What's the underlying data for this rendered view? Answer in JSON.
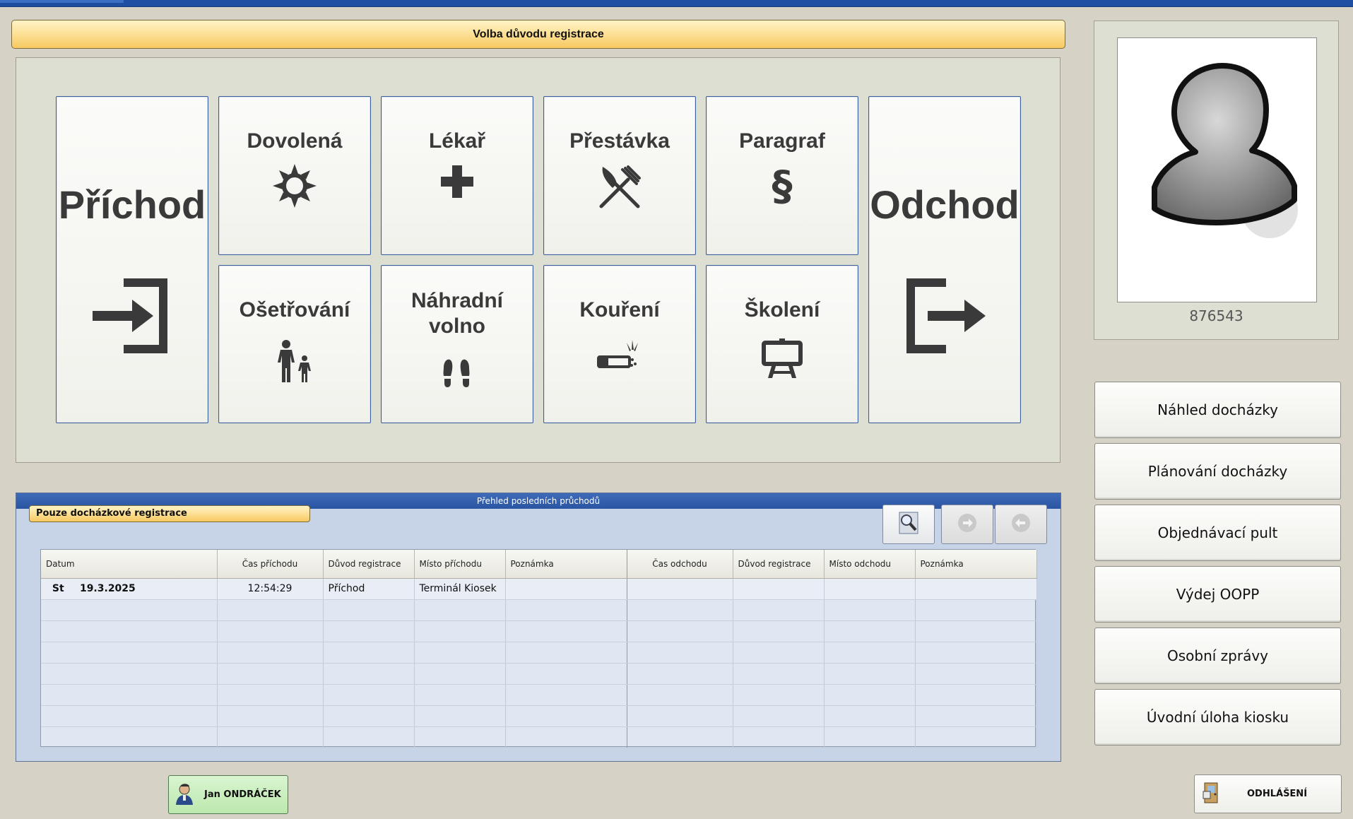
{
  "header": {
    "title": "Volba důvodu registrace"
  },
  "reasons": {
    "arrival": "Příchod",
    "vacation": "Dovolená",
    "doctor": "Lékař",
    "break": "Přestávka",
    "paragraph": "Paragraf",
    "departure": "Odchod",
    "care": "Ošetřování",
    "compensatory": "Náhradní volno",
    "smoking": "Kouření",
    "training": "Školení"
  },
  "employee": {
    "id": "876543",
    "name": "Jan ONDRÁČEK"
  },
  "side_menu": {
    "attendance_preview": "Náhled docházky",
    "attendance_planning": "Plánování docházky",
    "order_desk": "Objednávací pult",
    "ppe_issue": "Výdej OOPP",
    "personal_messages": "Osobní zprávy",
    "kiosk_home": "Úvodní úloha kiosku"
  },
  "history": {
    "title": "Přehled posledních průchodů",
    "filter_label": "Pouze docházkové registrace",
    "columns": {
      "date": "Datum",
      "arrival_time": "Čas příchodu",
      "arrival_reason": "Důvod registrace",
      "arrival_place": "Místo příchodu",
      "arrival_note": "Poznámka",
      "departure_time": "Čas odchodu",
      "departure_reason": "Důvod registrace",
      "departure_place": "Místo odchodu",
      "departure_note": "Poznámka"
    },
    "rows": [
      {
        "day": "St",
        "date": "19.3.2025",
        "arrival_time": "12:54:29",
        "arrival_reason": "Příchod",
        "arrival_place": "Terminál Kiosek",
        "arrival_note": "",
        "departure_time": "",
        "departure_reason": "",
        "departure_place": "",
        "departure_note": ""
      }
    ]
  },
  "logout": {
    "label": "ODHLÁŠENÍ"
  },
  "colors": {
    "title_gold": "#f7c960",
    "history_blue": "#2a55a2",
    "user_green": "#bce8ad",
    "tile_border": "#3a5f9c"
  }
}
